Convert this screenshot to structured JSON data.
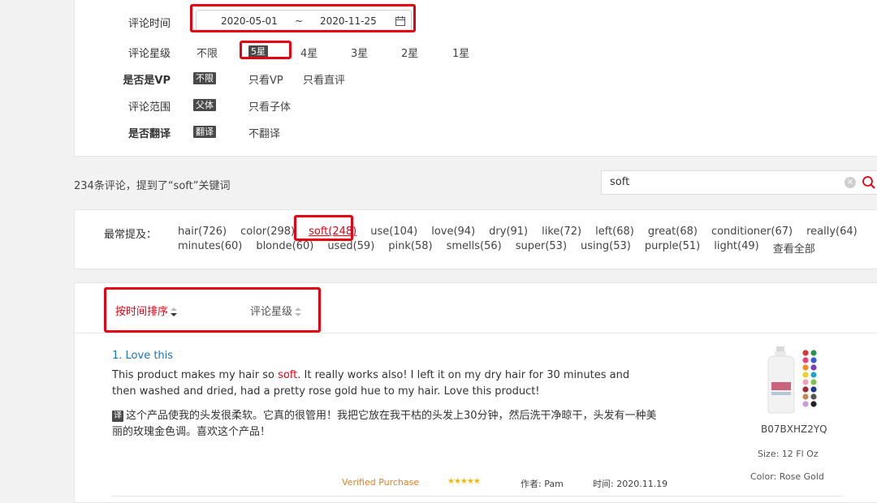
{
  "filters": {
    "time_label": "评论时间",
    "date_start": "2020-05-01",
    "date_sep": "~",
    "date_end": "2020-11-25",
    "star_label": "评论星级",
    "star_options": [
      "不限",
      "5星",
      "4星",
      "3星",
      "2星",
      "1星"
    ],
    "star_selected": "5星",
    "vp_label": "是否是VP",
    "vp_options": [
      "不限",
      "只看VP",
      "只看直评"
    ],
    "scope_label": "评论范围",
    "scope_options": [
      "父体",
      "只看子体"
    ],
    "translate_label": "是否翻译",
    "translate_options": [
      "翻译",
      "不翻译"
    ]
  },
  "summary": {
    "text": "234条评论，提到了“soft”关键词",
    "search_value": "soft",
    "clear_glyph": "×"
  },
  "keywords": {
    "label": "最常提及：",
    "row1": [
      "hair(726)",
      "color(298)",
      "soft(248)",
      "use(104)",
      "love(94)",
      "dry(91)",
      "like(72)",
      "left(68)",
      "great(68)",
      "conditioner(67)",
      "really(64)"
    ],
    "row2": [
      "minutes(60)",
      "blonde(60)",
      "used(59)",
      "pink(58)",
      "smells(56)",
      "super(53)",
      "using(53)",
      "purple(51)",
      "light(49)"
    ],
    "active": "soft(248)",
    "view_all": "查看全部"
  },
  "sort": {
    "by_time": "按时间排序",
    "by_rating": "评论星级"
  },
  "review": {
    "title": "1. Love this",
    "text_before": "This product makes my hair so ",
    "text_highlight": "soft",
    "text_after": ". It really works also! I left it on my dry hair for 30 minutes and then washed and dried, had a pretty rose gold hue to my hair. Love this product!",
    "translate_tag": "译",
    "translation": "这个产品使我的头发很柔软。它真的很管用！我把它放在我干枯的头发上30分钟，然后洗干净晾干，头发有一种美丽的玫瑰金色调。喜欢这个产品！",
    "verified": "Verified Purchase",
    "stars": "★★★★★",
    "author": "作者: Pam",
    "date": "时间: 2020.11.19"
  },
  "product": {
    "asin": "B07BXHZ2YQ",
    "size": "Size:  12 Fl Oz",
    "color": "Color:  Rose Gold"
  },
  "colors": {
    "accent_red": "#e60012",
    "link_blue": "#1a73c8",
    "verified_orange": "#d9822b",
    "star_gold": "#f6b700"
  }
}
